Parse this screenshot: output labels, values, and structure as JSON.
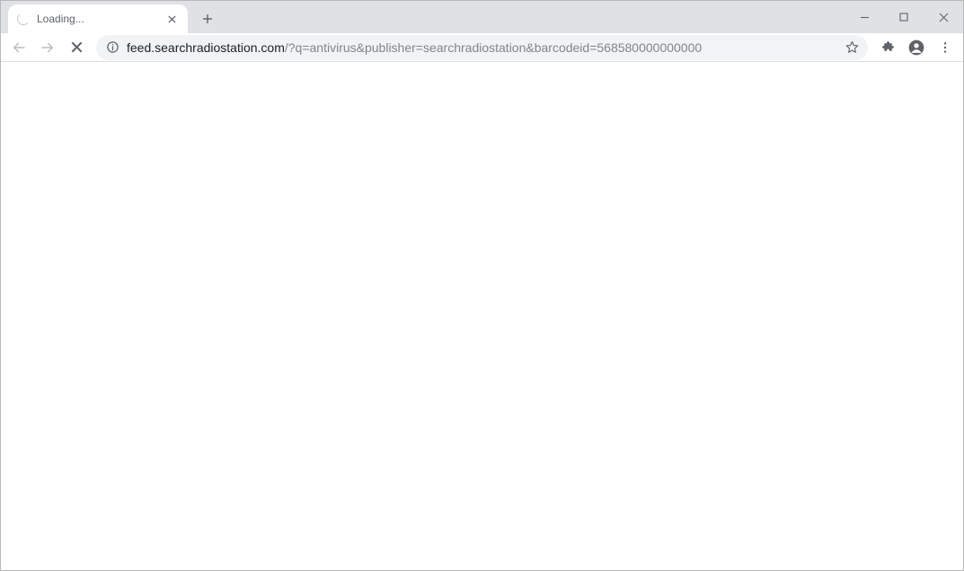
{
  "tab": {
    "title": "Loading..."
  },
  "omnibox": {
    "host": "feed.searchradiostation.com",
    "path": "/?q=antivirus&publisher=searchradiostation&barcodeid=568580000000000"
  }
}
